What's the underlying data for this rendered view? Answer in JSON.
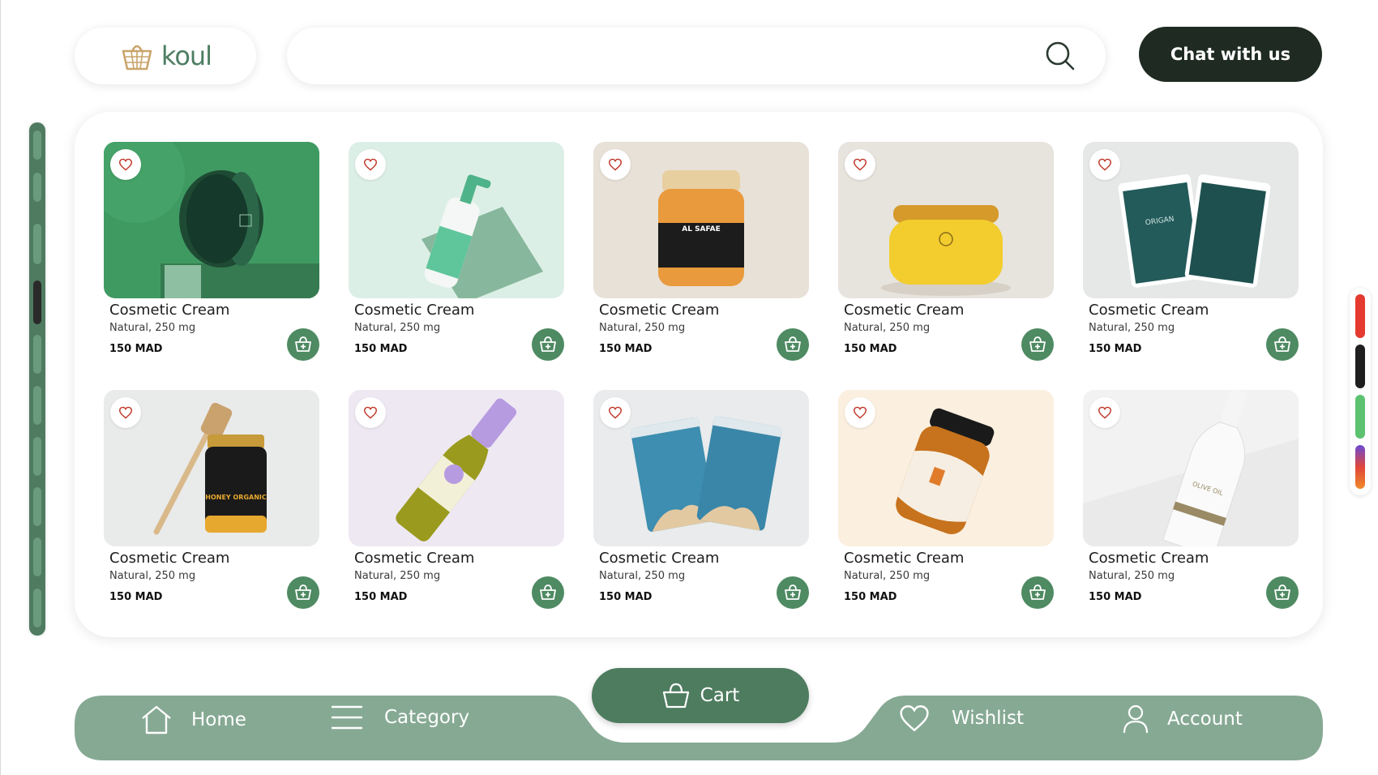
{
  "header": {
    "logo_text": "koul",
    "search_placeholder": "",
    "chat_label": "Chat with us"
  },
  "products": [
    {
      "name": "Cosmetic Cream",
      "desc": "Natural, 250 mg",
      "price": "150 MAD",
      "image": "green cream jar"
    },
    {
      "name": "Cosmetic Cream",
      "desc": "Natural, 250 mg",
      "price": "150 MAD",
      "image": "pump bottle"
    },
    {
      "name": "Cosmetic Cream",
      "desc": "Natural, 250 mg",
      "price": "150 MAD",
      "image": "honey jar",
      "image_text": "AL SAFAE"
    },
    {
      "name": "Cosmetic Cream",
      "desc": "Natural, 250 mg",
      "price": "150 MAD",
      "image": "yellow jar"
    },
    {
      "name": "Cosmetic Cream",
      "desc": "Natural, 250 mg",
      "price": "150 MAD",
      "image": "teal pouches",
      "image_text": "ORIGAN"
    },
    {
      "name": "Cosmetic Cream",
      "desc": "Natural, 250 mg",
      "price": "150 MAD",
      "image": "honey dipper jar",
      "image_text": "HONEY ORGANIC"
    },
    {
      "name": "Cosmetic Cream",
      "desc": "Natural, 250 mg",
      "price": "150 MAD",
      "image": "oil bottle"
    },
    {
      "name": "Cosmetic Cream",
      "desc": "Natural, 250 mg",
      "price": "150 MAD",
      "image": "blue pouches"
    },
    {
      "name": "Cosmetic Cream",
      "desc": "Natural, 250 mg",
      "price": "150 MAD",
      "image": "amber jar"
    },
    {
      "name": "Cosmetic Cream",
      "desc": "Natural, 250 mg",
      "price": "150 MAD",
      "image": "white olive oil bottle",
      "image_text": "OLIVE OIL"
    }
  ],
  "palette": [
    "#e53a2f",
    "#1f1f1f",
    "#5cc26f",
    "gradient-purple-orange"
  ],
  "nav": {
    "home": "Home",
    "category": "Category",
    "cart": "Cart",
    "wishlist": "Wishlist",
    "account": "Account"
  },
  "colors": {
    "accent": "#4e8a62",
    "nav_bg": "#86a993",
    "dark": "#1f2b22"
  }
}
